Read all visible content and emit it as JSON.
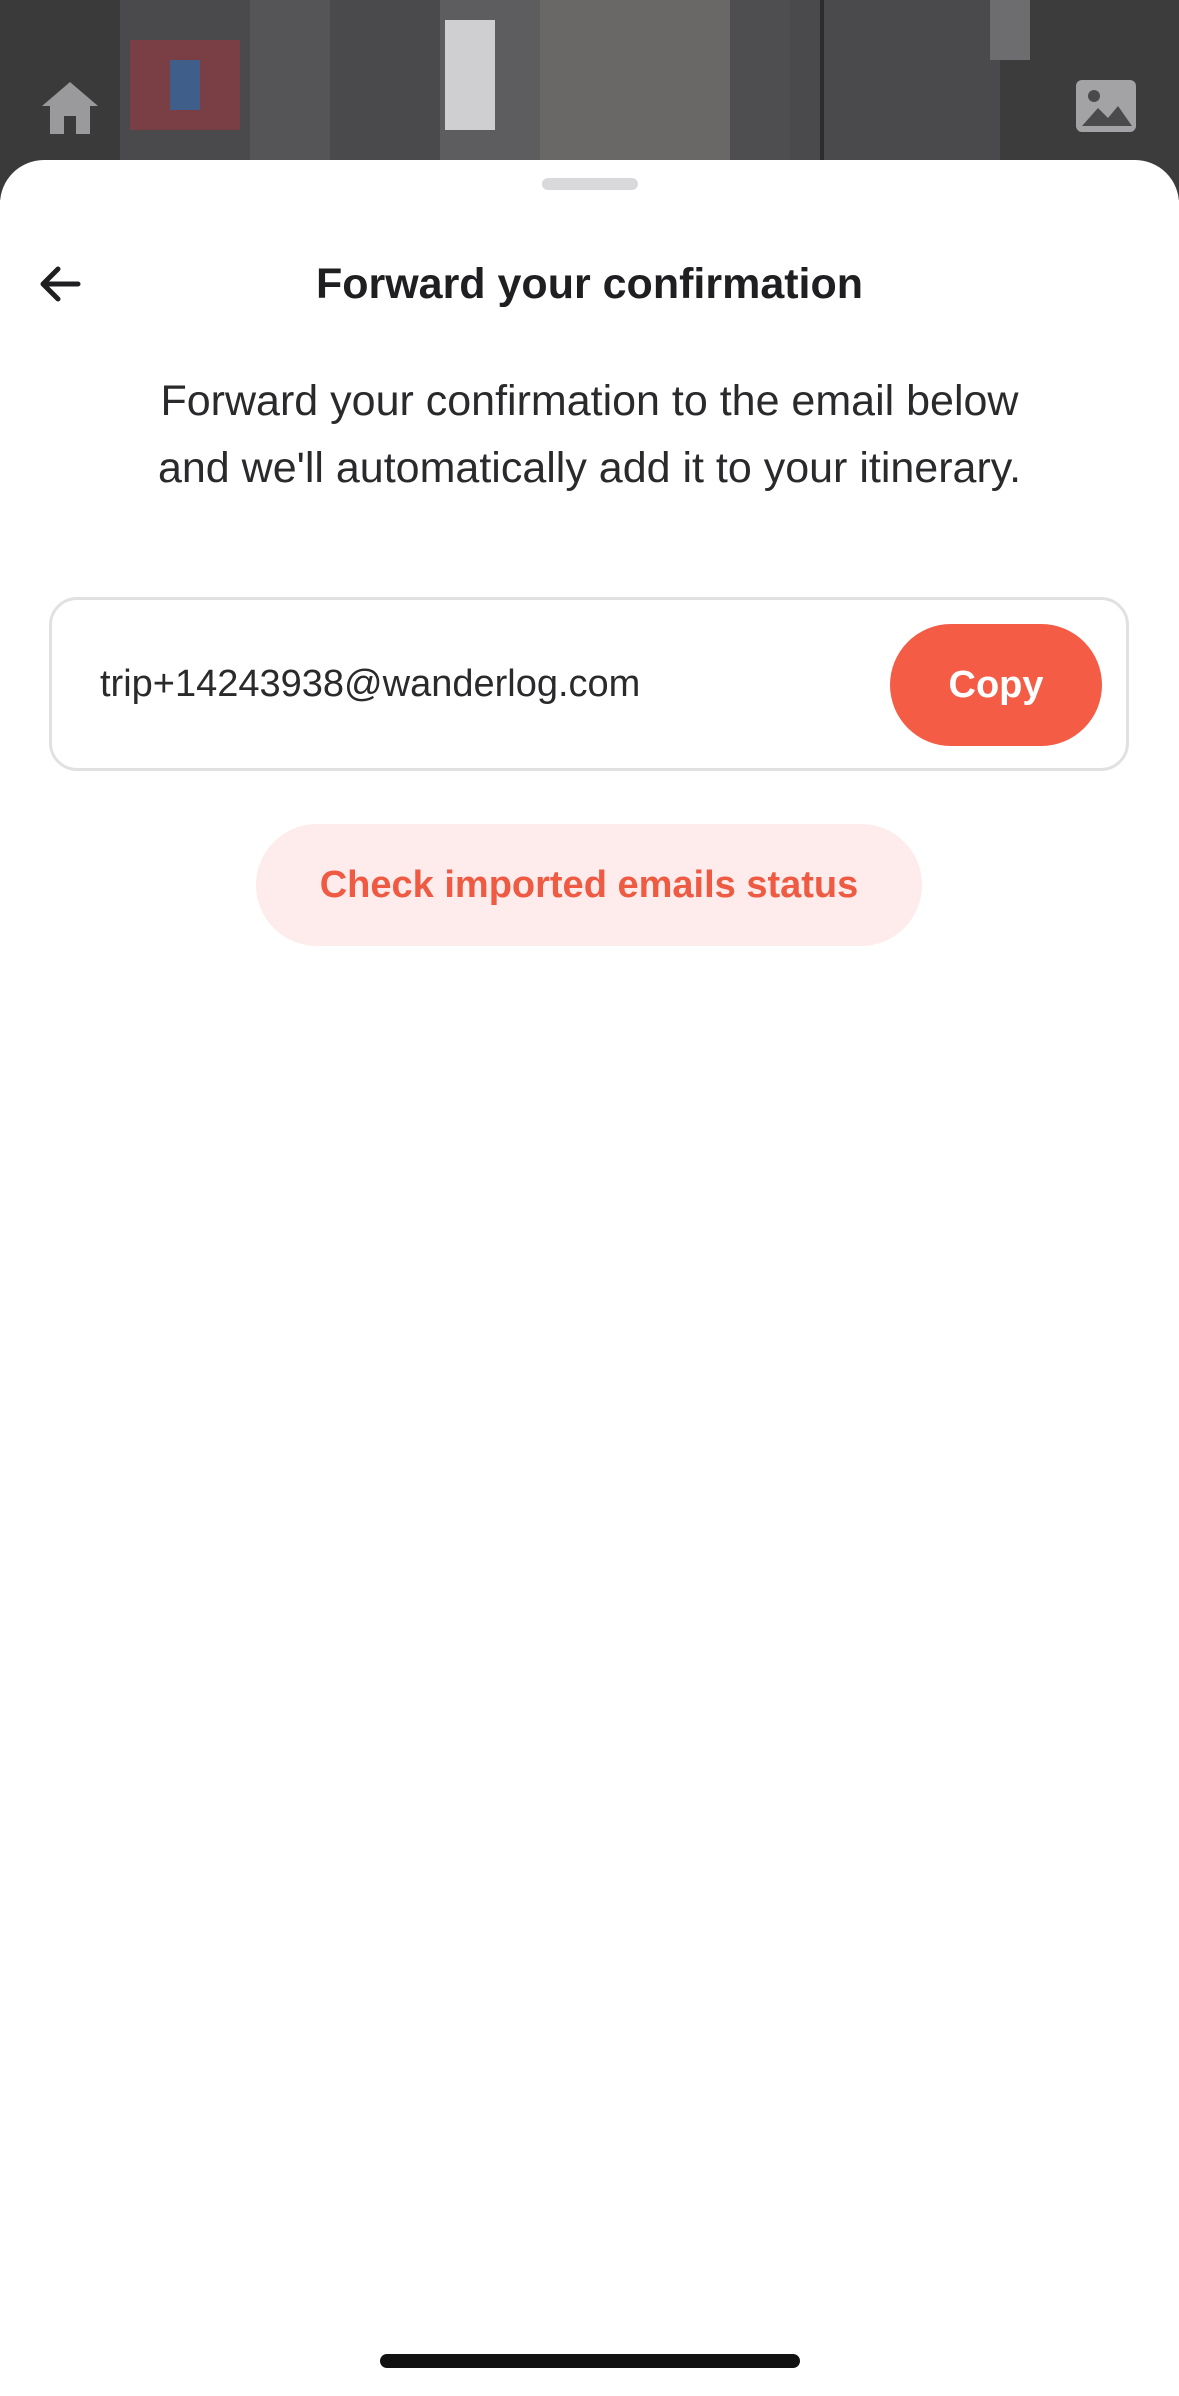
{
  "background": {
    "home_icon": "home-icon",
    "image_icon": "image-icon"
  },
  "sheet": {
    "back_icon": "arrow-left-icon",
    "title": "Forward your confirmation",
    "subtitle_line1": "Forward your confirmation to the email below",
    "subtitle_line2": "and we'll automatically add it to your itinerary.",
    "email": "trip+14243938@wanderlog.com",
    "copy_label": "Copy",
    "status_label": "Check imported emails status"
  },
  "colors": {
    "accent": "#f45c45",
    "accent_soft": "#fdeceb",
    "text": "#1f1f22"
  }
}
